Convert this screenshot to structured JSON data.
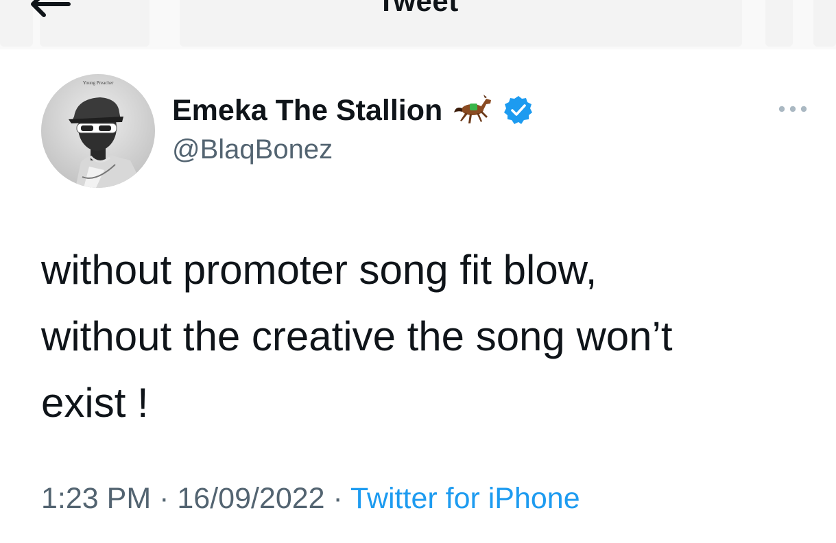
{
  "header": {
    "title": "Tweet",
    "back_icon": "back-arrow-icon"
  },
  "author": {
    "display_name": "Emeka The Stallion",
    "handle": "@BlaqBonez",
    "avatar_caption": "Young Preacher",
    "badges": [
      "horse-emoji-icon",
      "verified-badge-icon"
    ]
  },
  "tweet": {
    "lines": [
      "without promoter song fit blow,",
      "without the creative the song won’t",
      "exist !"
    ],
    "time": "1:23 PM",
    "date": "16/09/2022",
    "separator": "·",
    "source": "Twitter for iPhone"
  },
  "more_icon": "more-options-icon",
  "colors": {
    "text": "#0f1419",
    "secondary": "#536471",
    "link": "#1d9bf0",
    "verified": "#1d9bf0"
  }
}
